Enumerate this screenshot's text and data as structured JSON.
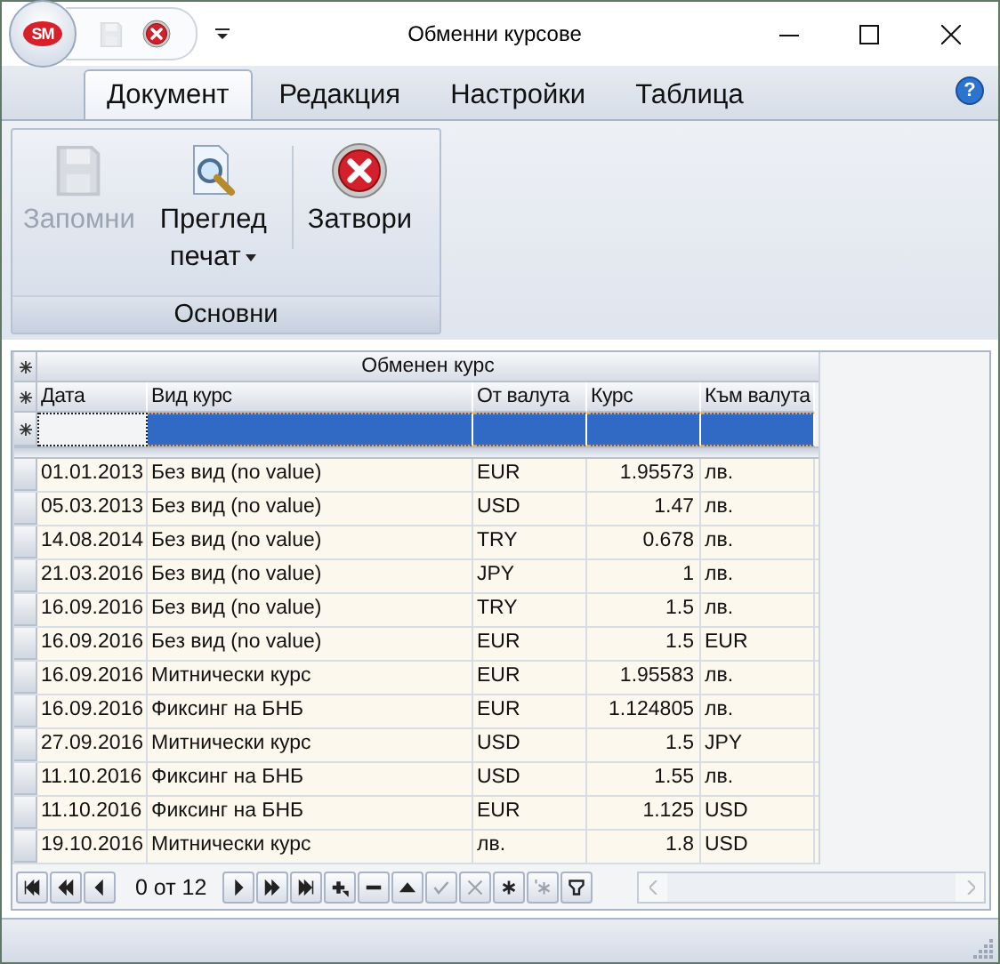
{
  "window": {
    "title": "Обменни курсове",
    "app_logo": "SM"
  },
  "quick_access": [
    {
      "kind": "save",
      "disabled": true
    },
    {
      "kind": "close",
      "disabled": false
    }
  ],
  "ribbon": {
    "tabs": [
      {
        "label": "Документ",
        "selected": true
      },
      {
        "label": "Редакция",
        "selected": false
      },
      {
        "label": "Настройки",
        "selected": false
      },
      {
        "label": "Таблица",
        "selected": false
      }
    ],
    "help": "?",
    "groups": [
      {
        "label": "Основни",
        "buttons": [
          {
            "label": "Запомни",
            "kind": "save",
            "disabled": true,
            "dropdown": false
          },
          {
            "label": "Преглед печат",
            "kind": "preview",
            "disabled": false,
            "dropdown": true
          },
          {
            "label": "Затвори",
            "kind": "close",
            "disabled": false,
            "dropdown": false
          }
        ]
      }
    ]
  },
  "grid": {
    "band": "Обменен курс",
    "new_row_selected": true,
    "columns": [
      {
        "label": "Дата",
        "numeric": false
      },
      {
        "label": "Вид курс",
        "numeric": false
      },
      {
        "label": "От валута",
        "numeric": false
      },
      {
        "label": "Курс",
        "numeric": true
      },
      {
        "label": "Към валута",
        "numeric": false
      }
    ],
    "rows": [
      {
        "cells": [
          "01.01.2013",
          "Без вид (no value)",
          "EUR",
          "1.95573",
          "лв."
        ]
      },
      {
        "cells": [
          "05.03.2013",
          "Без вид (no value)",
          "USD",
          "1.47",
          "лв."
        ]
      },
      {
        "cells": [
          "14.08.2014",
          "Без вид (no value)",
          "TRY",
          "0.678",
          "лв."
        ]
      },
      {
        "cells": [
          "21.03.2016",
          "Без вид (no value)",
          "JPY",
          "1",
          "лв."
        ]
      },
      {
        "cells": [
          "16.09.2016",
          "Без вид (no value)",
          "TRY",
          "1.5",
          "лв."
        ]
      },
      {
        "cells": [
          "16.09.2016",
          "Без вид (no value)",
          "EUR",
          "1.5",
          "EUR"
        ]
      },
      {
        "cells": [
          "16.09.2016",
          "Митнически курс",
          "EUR",
          "1.95583",
          "лв."
        ]
      },
      {
        "cells": [
          "16.09.2016",
          "Фиксинг на БНБ",
          "EUR",
          "1.124805",
          "лв."
        ]
      },
      {
        "cells": [
          "27.09.2016",
          "Митнически курс",
          "USD",
          "1.5",
          "JPY"
        ]
      },
      {
        "cells": [
          "11.10.2016",
          "Фиксинг на БНБ",
          "USD",
          "1.55",
          "лв."
        ]
      },
      {
        "cells": [
          "11.10.2016",
          "Фиксинг на БНБ",
          "EUR",
          "1.125",
          "USD"
        ]
      },
      {
        "cells": [
          "19.10.2016",
          "Митнически курс",
          "лв.",
          "1.8",
          "USD"
        ]
      }
    ]
  },
  "navigator": {
    "record_text": "0 от 12",
    "before": [
      {
        "kind": "first",
        "disabled": false
      },
      {
        "kind": "prev_page",
        "disabled": false
      },
      {
        "kind": "prev",
        "disabled": false
      }
    ],
    "after": [
      {
        "kind": "next",
        "disabled": false
      },
      {
        "kind": "next_page",
        "disabled": false
      },
      {
        "kind": "last",
        "disabled": false
      },
      {
        "kind": "insert",
        "disabled": false
      },
      {
        "kind": "delete",
        "disabled": false
      },
      {
        "kind": "edit",
        "disabled": false
      },
      {
        "kind": "post",
        "disabled": true
      },
      {
        "kind": "cancel",
        "disabled": true
      },
      {
        "kind": "refresh",
        "disabled": false
      },
      {
        "kind": "bookmark",
        "disabled": true
      },
      {
        "kind": "filter",
        "disabled": false
      }
    ]
  }
}
